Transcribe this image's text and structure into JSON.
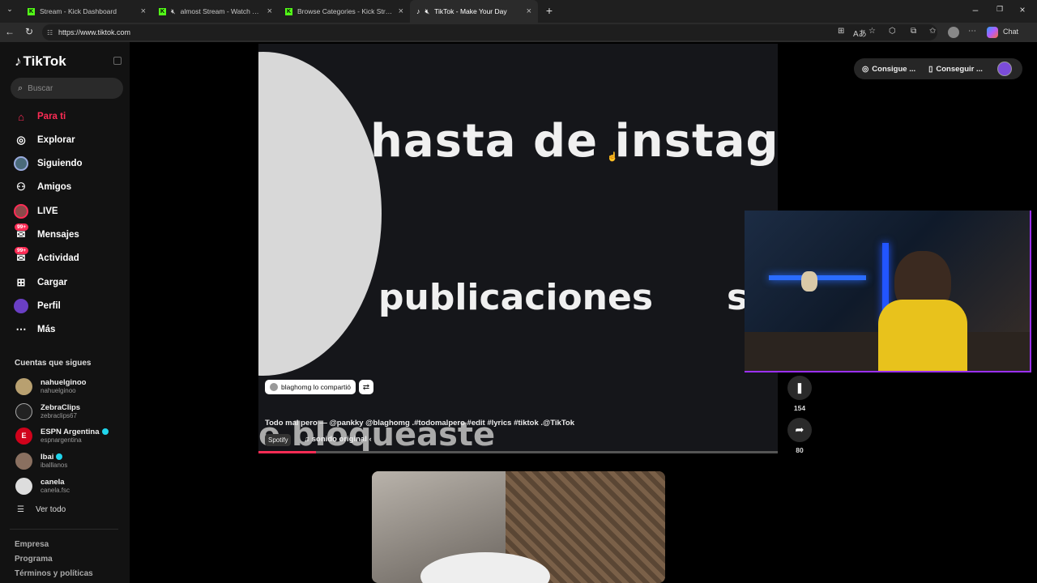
{
  "browser": {
    "tabs": [
      {
        "title": "Stream - Kick Dashboard",
        "active": false
      },
      {
        "title": "almost Stream - Watch Live o",
        "active": false
      },
      {
        "title": "Browse Categories - Kick Streamin",
        "active": false
      },
      {
        "title": "TikTok - Make Your Day",
        "active": true
      }
    ],
    "url": "https://www.tiktok.com",
    "chat_label": "Chat"
  },
  "sidebar": {
    "logo": "TikTok",
    "search_placeholder": "Buscar",
    "nav": [
      {
        "label": "Para ti",
        "icon": "home-icon"
      },
      {
        "label": "Explorar",
        "icon": "compass-icon"
      },
      {
        "label": "Siguiendo",
        "icon": "following-icon"
      },
      {
        "label": "Amigos",
        "icon": "friends-icon"
      },
      {
        "label": "LIVE",
        "icon": "live-icon"
      },
      {
        "label": "Mensajes",
        "icon": "messages-icon",
        "badge": "99+"
      },
      {
        "label": "Actividad",
        "icon": "activity-icon",
        "badge": "99+"
      },
      {
        "label": "Cargar",
        "icon": "upload-icon"
      },
      {
        "label": "Perfil",
        "icon": "profile-icon"
      },
      {
        "label": "Más",
        "icon": "more-icon"
      }
    ],
    "following_title": "Cuentas que sigues",
    "accounts": [
      {
        "name": "nahuelginoo",
        "handle": "nahuelginoo",
        "verified": false
      },
      {
        "name": "ZebraClips",
        "handle": "zebraclips67",
        "verified": false
      },
      {
        "name": "ESPN Argentina",
        "handle": "espnargentina",
        "verified": true
      },
      {
        "name": "Ibai",
        "handle": "iballlanos",
        "verified": true
      },
      {
        "name": "canela",
        "handle": "canela.fsc",
        "verified": false
      }
    ],
    "see_all": "Ver todo",
    "footer": [
      "Empresa",
      "Programa",
      "Términos y políticas"
    ]
  },
  "video": {
    "caption_line1": "hasta de instag",
    "caption_line2": "publicaciones",
    "caption_line2_tail": "s",
    "caption_line3": "e bloqueaste",
    "shared_by": "blaghomg lo compartió",
    "description": "Todo mal pero — @pankky @blaghomg .#todomalpero #edit #lyrics #tiktok .@TikTok",
    "spotify_label": "Spotify",
    "music": "♫ sonido original ‹",
    "progress_fraction": 0.11
  },
  "actions": {
    "bookmark_count": "154",
    "share_count": "80"
  },
  "topbar": {
    "get_coins": "Consigue ...",
    "get_app": "Conseguir ..."
  },
  "colors": {
    "accent": "#fe2c55",
    "stream_border": "#9b30ff",
    "kick_green": "#53fc18"
  }
}
